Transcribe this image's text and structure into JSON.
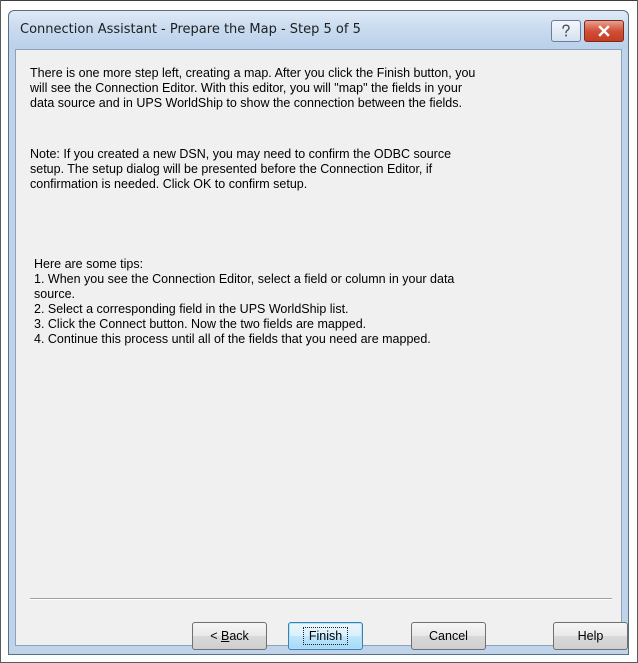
{
  "window": {
    "title": "Connection Assistant - Prepare the Map - Step 5 of 5",
    "help_glyph": "?",
    "close_glyph": "×"
  },
  "content": {
    "paragraph_1": "There is one more step left, creating a map. After you click the Finish button, you\nwill see the Connection Editor. With this editor, you will  \"map\" the fields in your\ndata source and in UPS WorldShip to show the connection between the fields.",
    "paragraph_2": "Note: If you created a new DSN, you may need to confirm the ODBC source\nsetup. The setup dialog will be presented before the Connection Editor, if\nconfirmation is needed.  Click OK to confirm setup.",
    "tips": "Here are some tips:\n1. When you see the Connection Editor, select a field or column in your data\nsource.\n2. Select a corresponding field in the  UPS WorldShip list.\n3. Click the Connect button. Now the two fields are mapped.\n4. Continue this process until all of the fields that you need are mapped."
  },
  "buttons": {
    "back_prefix": "< ",
    "back_mnemonic": "B",
    "back_rest": "ack",
    "finish": "Finish",
    "cancel": "Cancel",
    "help": "Help"
  },
  "colors": {
    "titlebar": "#c9dbef",
    "dialog_background": "#f0f0f0",
    "close_button": "#c73a22"
  }
}
